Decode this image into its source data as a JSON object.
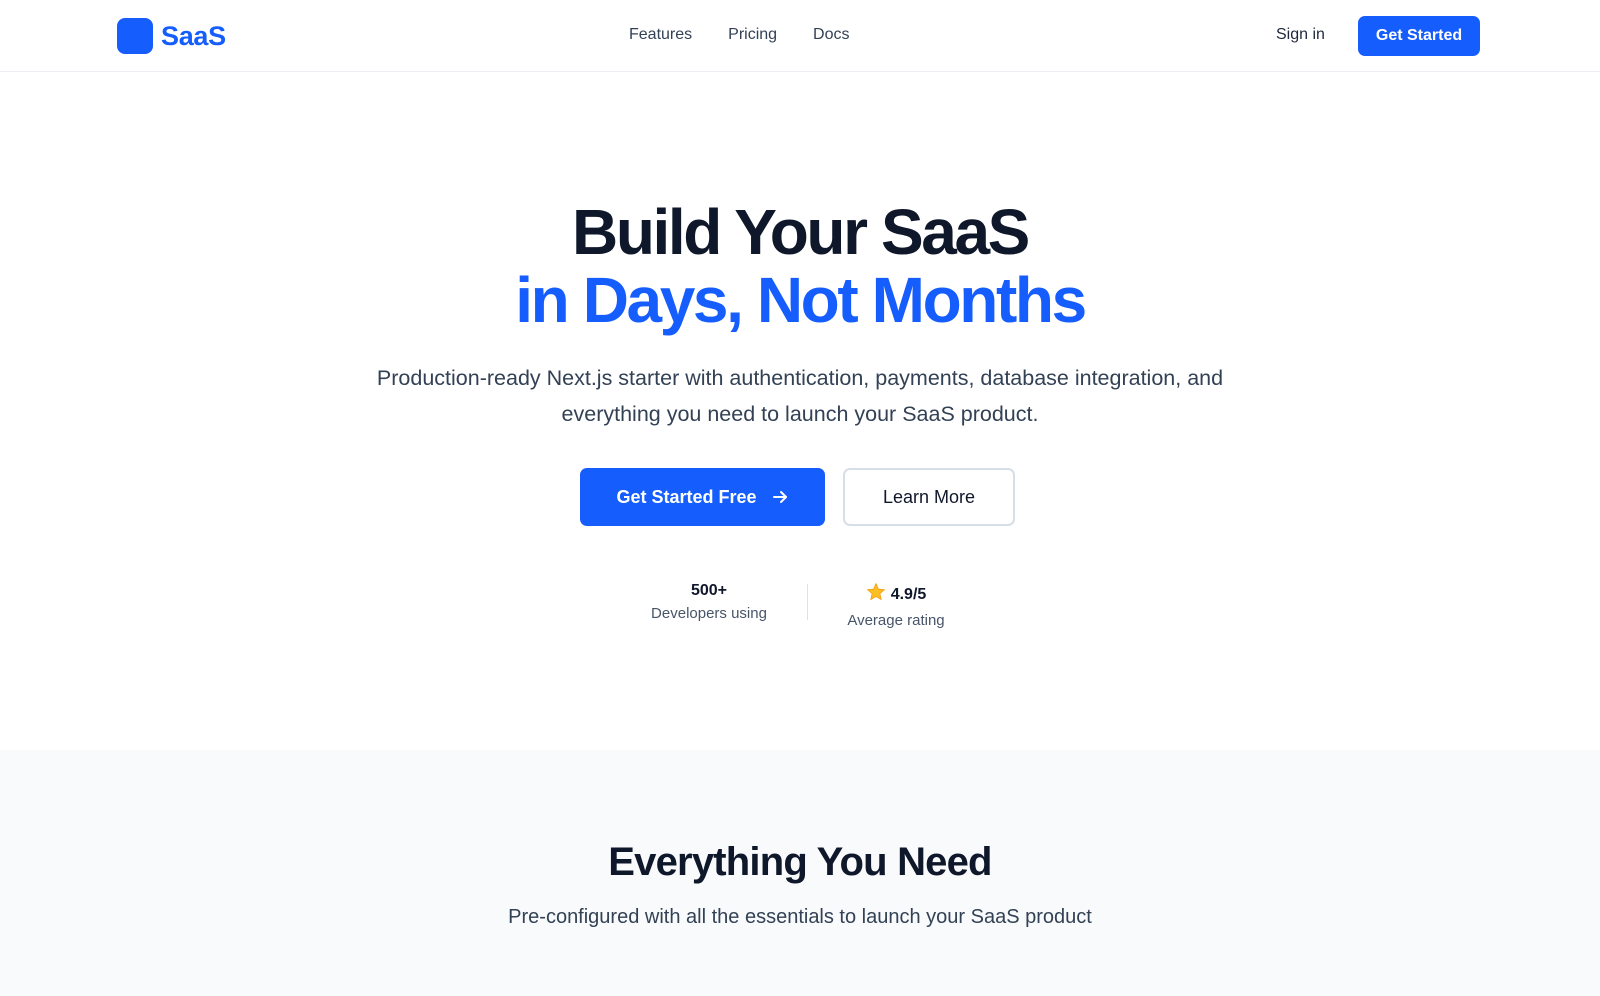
{
  "colors": {
    "brand": "#155dfc",
    "heading": "#0f172a",
    "body": "#334155",
    "section_bg": "#f8fafc"
  },
  "header": {
    "logo_text": "SaaS",
    "nav": [
      {
        "label": "Features"
      },
      {
        "label": "Pricing"
      },
      {
        "label": "Docs"
      }
    ],
    "sign_in": "Sign in",
    "cta_label": "Get Started"
  },
  "hero": {
    "title_line1": "Build Your SaaS",
    "title_line2": "in Days, Not Months",
    "subtitle": "Production-ready Next.js starter with authentication, payments, database integration, and everything you need to launch your SaaS product.",
    "primary_cta": "Get Started Free",
    "primary_cta_icon": "arrow-right-icon",
    "secondary_cta": "Learn More",
    "stats": [
      {
        "value": "500+",
        "label": "Developers using"
      },
      {
        "value": "4.9/5",
        "label": "Average rating",
        "icon": "star-icon"
      }
    ]
  },
  "features": {
    "title": "Everything You Need",
    "subtitle": "Pre-configured with all the essentials to launch your SaaS product"
  }
}
